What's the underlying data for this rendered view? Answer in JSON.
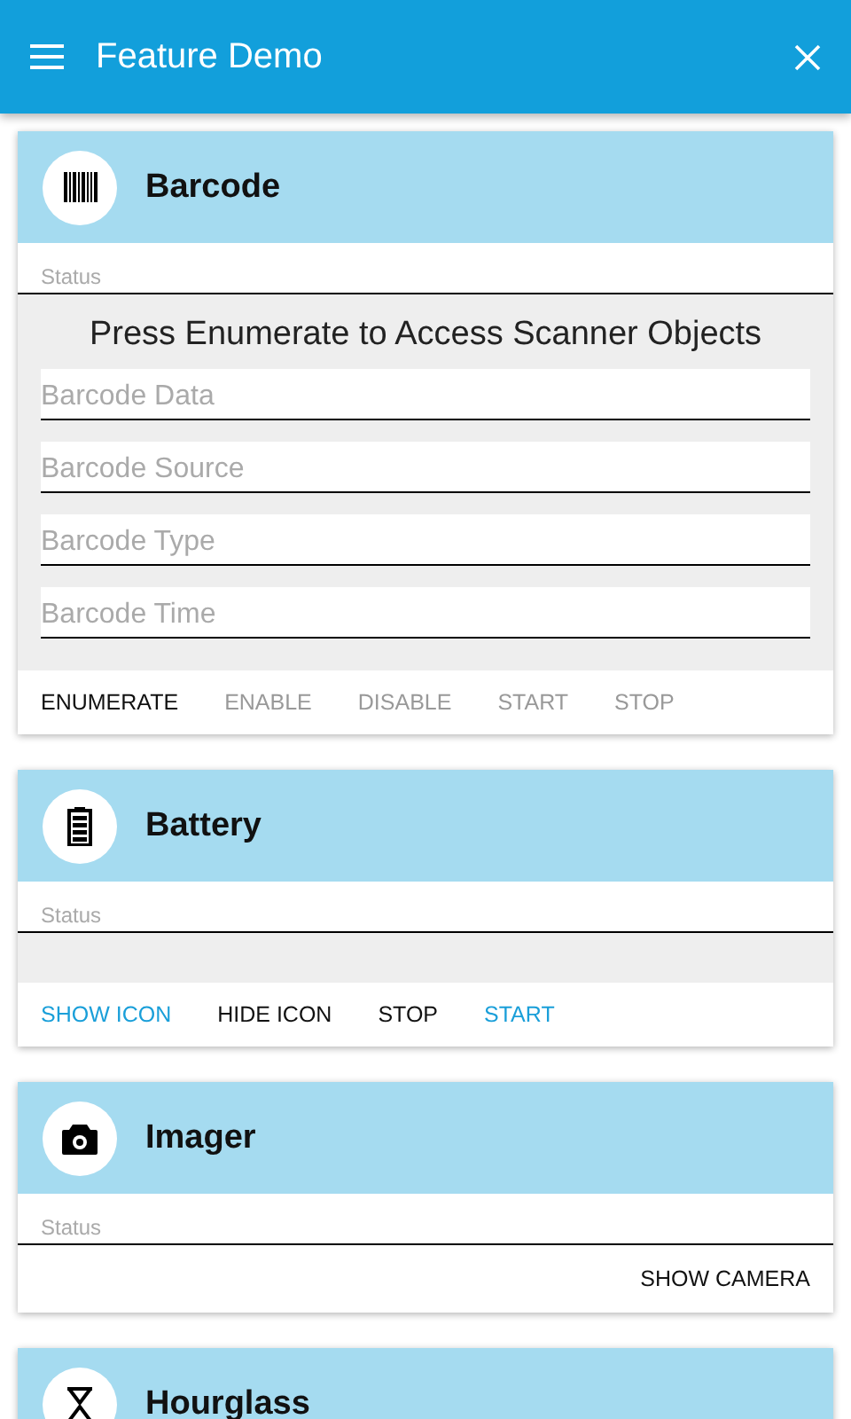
{
  "app_bar": {
    "title": "Feature Demo"
  },
  "cards": [
    {
      "kind": "barcode",
      "title": "Barcode",
      "status": {
        "placeholder": "Status"
      },
      "panel": {
        "heading": "Press Enumerate to Access Scanner Objects",
        "fields": [
          {
            "placeholder": "Barcode Data"
          },
          {
            "placeholder": "Barcode Source"
          },
          {
            "placeholder": "Barcode Type"
          },
          {
            "placeholder": "Barcode Time"
          }
        ]
      },
      "buttons": [
        {
          "label": "ENUMERATE",
          "disabled": false,
          "highlighted": false
        },
        {
          "label": "ENABLE",
          "disabled": true,
          "highlighted": false
        },
        {
          "label": "DISABLE",
          "disabled": true,
          "highlighted": false
        },
        {
          "label": "START",
          "disabled": true,
          "highlighted": false
        },
        {
          "label": "STOP",
          "disabled": true,
          "highlighted": false
        }
      ]
    },
    {
      "kind": "battery",
      "title": "Battery",
      "status": {
        "placeholder": "Status"
      },
      "blank_panel": true,
      "buttons": [
        {
          "label": "SHOW ICON",
          "disabled": false,
          "highlighted": true
        },
        {
          "label": "HIDE ICON",
          "disabled": false,
          "highlighted": false
        },
        {
          "label": "STOP",
          "disabled": false,
          "highlighted": false
        },
        {
          "label": "START",
          "disabled": false,
          "highlighted": true
        }
      ]
    },
    {
      "kind": "imager",
      "title": "Imager",
      "status": {
        "placeholder": "Status"
      },
      "buttons": [
        {
          "label": "SHOW CAMERA",
          "disabled": false,
          "highlighted": false
        }
      ]
    },
    {
      "kind": "hourglass",
      "title": "Hourglass"
    }
  ]
}
